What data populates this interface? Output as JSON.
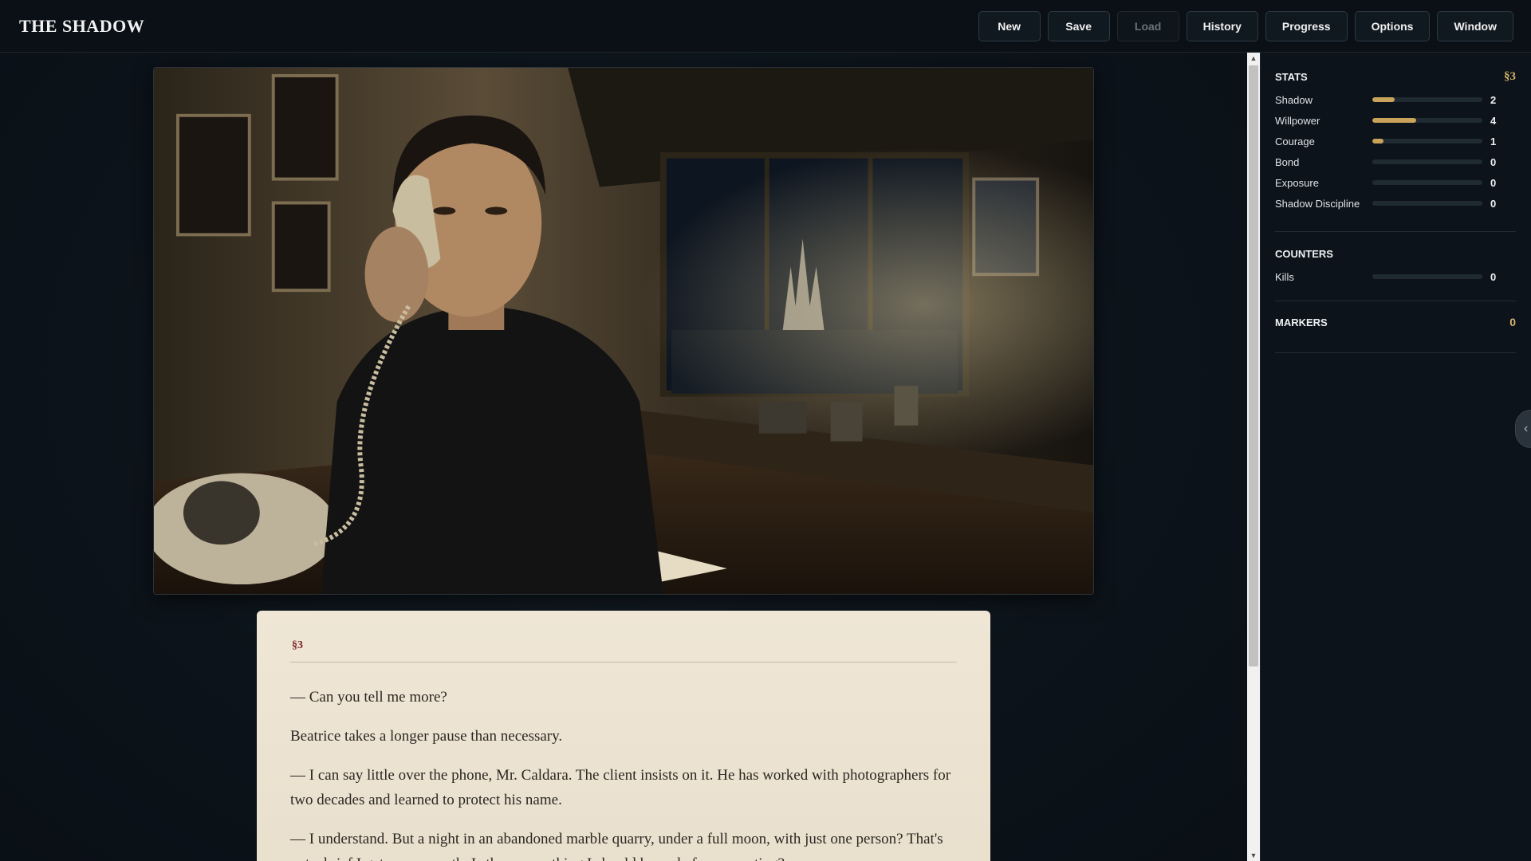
{
  "app": {
    "title": "THE SHADOW"
  },
  "menu": {
    "new": "New",
    "save": "Save",
    "load": "Load",
    "history": "History",
    "progress": "Progress",
    "options": "Options",
    "window": "Window"
  },
  "story": {
    "section": "§3",
    "paragraphs": [
      "— Can you tell me more?",
      "Beatrice takes a longer pause than necessary.",
      "— I can say little over the phone, Mr. Caldara. The client insists on it. He has worked with photographers for two decades and learned to protect his name.",
      "— I understand. But a night in an abandoned marble quarry, under a full moon, with just one person? That's not a brief I get every month. Is there something I should know before accepting?"
    ]
  },
  "sidebar": {
    "stats": {
      "title": "STATS",
      "section_ref": "§3",
      "items": [
        {
          "name": "Shadow",
          "value": "2",
          "fill": 0.2
        },
        {
          "name": "Willpower",
          "value": "4",
          "fill": 0.4
        },
        {
          "name": "Courage",
          "value": "1",
          "fill": 0.1
        },
        {
          "name": "Bond",
          "value": "0",
          "fill": 0
        },
        {
          "name": "Exposure",
          "value": "0",
          "fill": 0
        },
        {
          "name": "Shadow Discipline",
          "value": "0",
          "fill": 0
        }
      ]
    },
    "counters": {
      "title": "COUNTERS",
      "items": [
        {
          "name": "Kills",
          "value": "0",
          "fill": 0
        }
      ]
    },
    "markers": {
      "title": "MARKERS",
      "count": "0"
    }
  },
  "colors": {
    "accent": "#c9a35a",
    "section_ref": "#d6b46c",
    "story_bg": "#efe6d6",
    "section_label": "#7a2320"
  },
  "icons": {
    "sidebar_toggle": "chevron-left-icon"
  }
}
